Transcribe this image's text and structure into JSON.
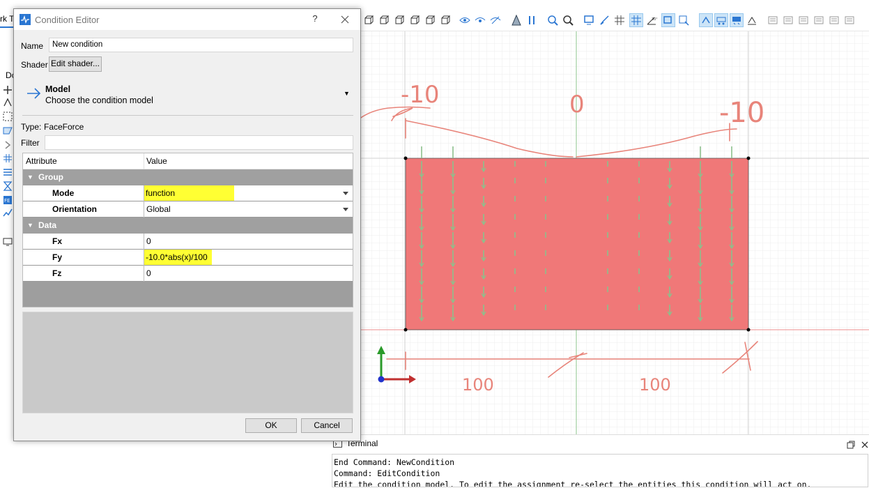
{
  "app": {
    "left_tab_fragment": "rk T",
    "left_fragment": "Dc"
  },
  "dialog": {
    "title": "Condition Editor",
    "help": "?",
    "name_label": "Name",
    "name_value": "New condition",
    "shader_label": "Shader",
    "edit_shader_button": "Edit shader...",
    "model_title": "Model",
    "model_subtitle": "Choose the condition model",
    "type_label": "Type:",
    "type_value": "FaceForce",
    "filter_label": "Filter",
    "filter_value": "",
    "grid": {
      "col_attribute": "Attribute",
      "col_value": "Value",
      "group1": "Group",
      "mode_label": "Mode",
      "mode_value": "function",
      "orientation_label": "Orientation",
      "orientation_value": "Global",
      "group2": "Data",
      "fx_label": "Fx",
      "fx_value": "0",
      "fy_label": "Fy",
      "fy_value": "-10.0*abs(x)/100",
      "fz_label": "Fz",
      "fz_value": "0"
    },
    "ok_button": "OK",
    "cancel_button": "Cancel",
    "highlight_color": "#ffff33"
  },
  "annotations": {
    "top_left": "-10",
    "top_center": "0",
    "top_right": "-10",
    "dim_left": "100",
    "dim_right": "100",
    "ink_color": "#e8847a"
  },
  "model_view": {
    "face_color": "#f07878",
    "force_arrow_color": "#8cc08c"
  },
  "terminal": {
    "title": "Terminal",
    "lines": [
      "End Command: NewCondition",
      "Command: EditCondition",
      "Edit the condition model. To edit the assignment re-select the entities this condition will act on."
    ]
  }
}
